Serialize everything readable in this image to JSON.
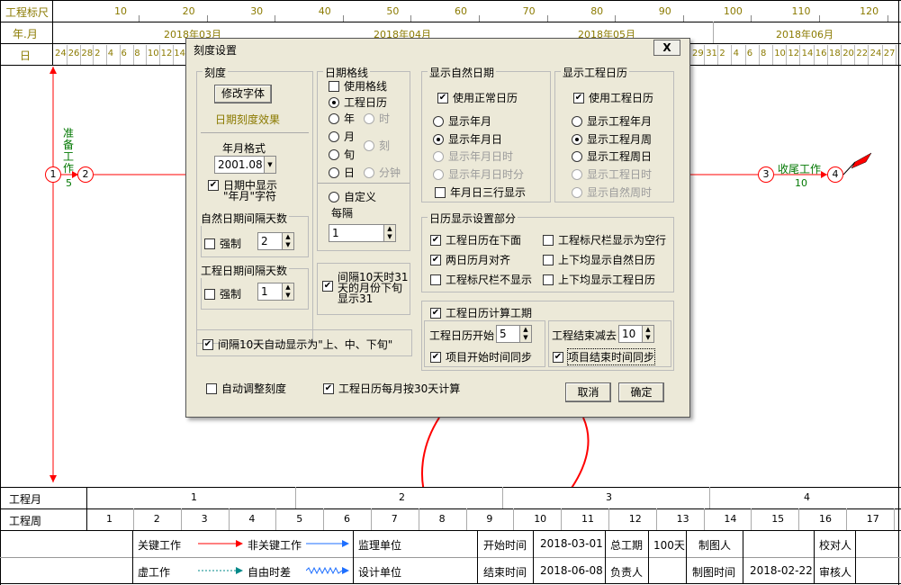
{
  "scale": {
    "ruler_title": "工程标尺",
    "ruler_ticks": [
      "10",
      "20",
      "30",
      "40",
      "50",
      "60",
      "70",
      "80",
      "90",
      "100",
      "110",
      "120"
    ],
    "ym_title": "年.月",
    "months": [
      "2018年03月",
      "2018年04月",
      "2018年05月",
      "2018年06月"
    ],
    "day_title": "日",
    "days_left": [
      "24",
      "26",
      "28",
      "2",
      "4",
      "6",
      "8",
      "10",
      "12",
      "14"
    ],
    "days_right": [
      "29",
      "31",
      "2",
      "4",
      "6",
      "8",
      "10",
      "12",
      "14",
      "16",
      "18",
      "20",
      "22",
      "24",
      "27"
    ]
  },
  "network": {
    "node1": "1",
    "node2": "2",
    "node3": "3",
    "node4": "4",
    "task_a_name": "准备工作",
    "task_a_dur": "5",
    "task_b_name": "收尾工作",
    "task_b_dur": "10"
  },
  "bottom": {
    "proj_month_title": "工程月",
    "proj_months": [
      "1",
      "2",
      "3",
      "4"
    ],
    "proj_week_title": "工程周",
    "proj_weeks": [
      "1",
      "2",
      "3",
      "4",
      "5",
      "6",
      "7",
      "8",
      "9",
      "10",
      "11",
      "12",
      "13",
      "14",
      "15",
      "16",
      "17"
    ]
  },
  "legend": {
    "critical": "关键工作",
    "noncritical": "非关键工作",
    "virtual": "虚工作",
    "float": "自由时差",
    "supervisor": "监理单位",
    "designer": "设计单位",
    "start_label": "开始时间",
    "start_value": "2018-03-01",
    "end_label": "结束时间",
    "end_value": "2018-06-08",
    "total_label": "总工期",
    "total_value": "100天",
    "owner_label": "负责人",
    "drawer_label": "制图人",
    "draw_time_label": "制图时间",
    "draw_time_value": "2018-02-22",
    "checker_label": "校对人",
    "reviewer_label": "审核人"
  },
  "dialog": {
    "title": "刻度设置",
    "close": "X",
    "scale_group": "刻度",
    "font_button": "修改字体",
    "effect_label": "日期刻度效果",
    "ym_format_label": "年月格式",
    "ym_format_value": "2001.08",
    "show_ym_text": "日期中显示\n\"年月\"字符",
    "natural_interval_group": "自然日期间隔天数",
    "force1": "强制",
    "natural_interval_value": "2",
    "proj_interval_group": "工程日期间隔天数",
    "force2": "强制",
    "proj_interval_value": "1",
    "auto_xun": "间隔10天自动显示为\"上、中、下旬\"",
    "auto_adjust": "自动调整刻度",
    "month30": "工程日历每月按30天计算",
    "gridline_group": "日期格线",
    "use_gridline": "使用格线",
    "proj_calendar": "工程日历",
    "opt_year": "年",
    "opt_hour": "时",
    "opt_month": "月",
    "opt_quarter": "刻",
    "opt_xun": "旬",
    "opt_minute": "分钟",
    "opt_day": "日",
    "custom": "自定义",
    "every_label": "每隔",
    "every_value": "1",
    "interval31": "间隔10天时31\n天的月份下旬\n显示31",
    "natural_group": "显示自然日期",
    "use_normal_cal": "使用正常日历",
    "show_ym": "显示年月",
    "show_ymd": "显示年月日",
    "show_ymdh": "显示年月日时",
    "show_ymdhm": "显示年月日时分",
    "three_rows": "年月日三行显示",
    "proj_group": "显示工程日历",
    "use_proj_cal": "使用工程日历",
    "show_proj_ym": "显示工程年月",
    "show_proj_mw": "显示工程月周",
    "show_proj_wd": "显示工程周日",
    "show_proj_dh": "显示工程日时",
    "show_nat_wh": "显示自然周时",
    "cal_setting_group": "日历显示设置部分",
    "proj_below": "工程日历在下面",
    "ruler_blank": "工程标尺栏显示为空行",
    "two_align": "两日历月对齐",
    "both_natural": "上下均显示自然日历",
    "ruler_hide": "工程标尺栏不显示",
    "both_proj": "上下均显示工程日历",
    "calc_period": "工程日历计算工期",
    "proj_start_label": "工程日历开始",
    "proj_start_value": "5",
    "end_minus_label": "工程结束减去",
    "end_minus_value": "10",
    "sync_start": "项目开始时间同步",
    "sync_end": "项目结束时间同步",
    "cancel": "取消",
    "ok": "确定"
  },
  "colors": {
    "critical": "#ff0000",
    "noncritical": "#1e6fff",
    "float": "#1e6fff",
    "olive": "#8B7A00",
    "green": "#007700"
  }
}
